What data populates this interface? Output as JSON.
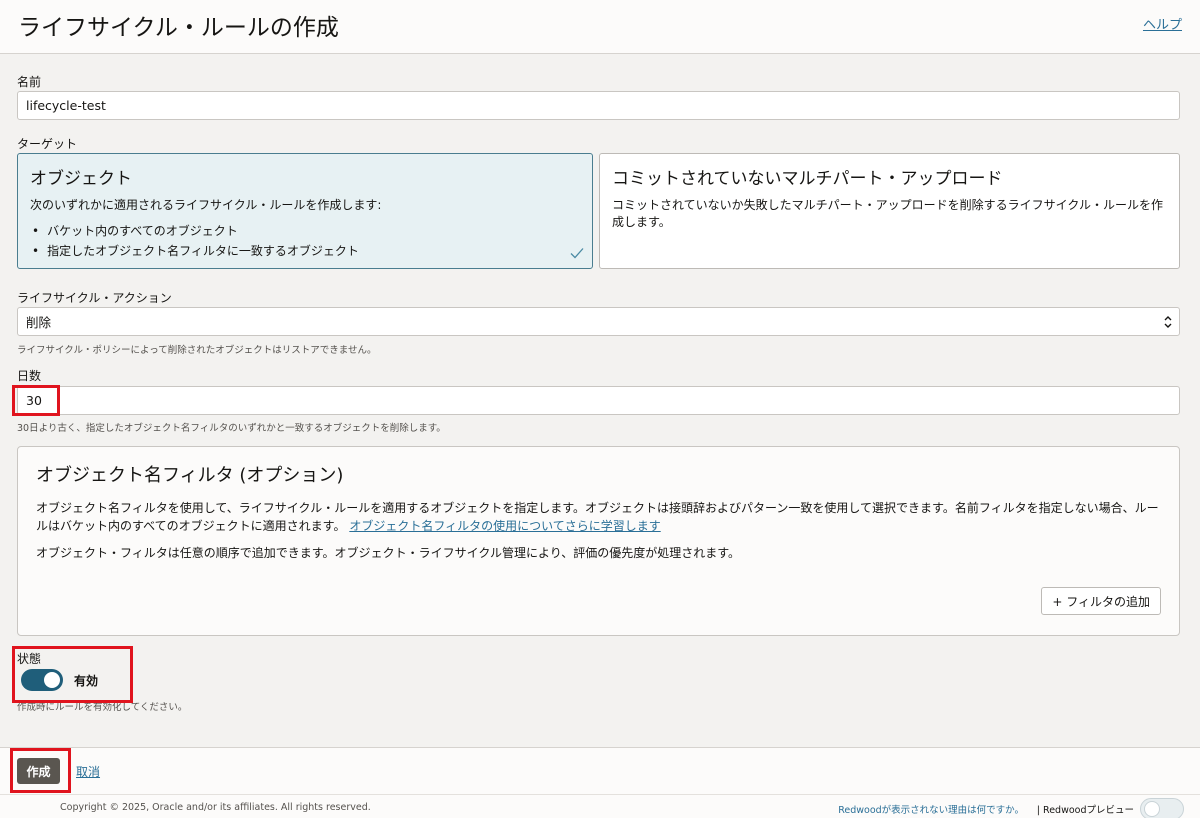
{
  "header": {
    "title": "ライフサイクル・ルールの作成",
    "help_label": "ヘルプ"
  },
  "name_field": {
    "label": "名前",
    "value": "lifecycle-test"
  },
  "target": {
    "label": "ターゲット",
    "cards": [
      {
        "title": "オブジェクト",
        "text": "次のいずれかに適用されるライフサイクル・ルールを作成します:",
        "bullets": [
          "バケット内のすべてのオブジェクト",
          "指定したオブジェクト名フィルタに一致するオブジェクト"
        ],
        "selected": true
      },
      {
        "title": "コミットされていないマルチパート・アップロード",
        "text": "コミットされていないか失敗したマルチパート・アップロードを削除するライフサイクル・ルールを作成します。",
        "selected": false
      }
    ]
  },
  "action": {
    "label": "ライフサイクル・アクション",
    "value": "削除",
    "hint": "ライフサイクル・ポリシーによって削除されたオブジェクトはリストアできません。"
  },
  "days": {
    "label": "日数",
    "value": "30",
    "hint": "30日より古く、指定したオブジェクト名フィルタのいずれかと一致するオブジェクトを削除します。"
  },
  "filter": {
    "title": "オブジェクト名フィルタ (オプション)",
    "text": "オブジェクト名フィルタを使用して、ライフサイクル・ルールを適用するオブジェクトを指定します。オブジェクトは接頭辞およびパターン一致を使用して選択できます。名前フィルタを指定しない場合、ルールはバケット内のすべてのオブジェクトに適用されます。",
    "link": "オブジェクト名フィルタの使用についてさらに学習します",
    "text2": "オブジェクト・フィルタは任意の順序で追加できます。オブジェクト・ライフサイクル管理により、評価の優先度が処理されます。",
    "add_button": "+ フィルタの追加"
  },
  "state": {
    "label": "状態",
    "toggle_label": "有効",
    "hint": "作成時にルールを有効化してください。"
  },
  "footer": {
    "create_label": "作成",
    "cancel_label": "取消",
    "copyright": "Copyright © 2025, Oracle and/or its affiliates. All rights reserved.",
    "redwood_link": "Redwoodが表示されない理由は何ですか。",
    "redwood_preview": "| Redwoodプレビュー"
  },
  "colors": {
    "highlight": "#e0141e",
    "accent": "#1f5e7a",
    "link": "#2a6f97"
  }
}
